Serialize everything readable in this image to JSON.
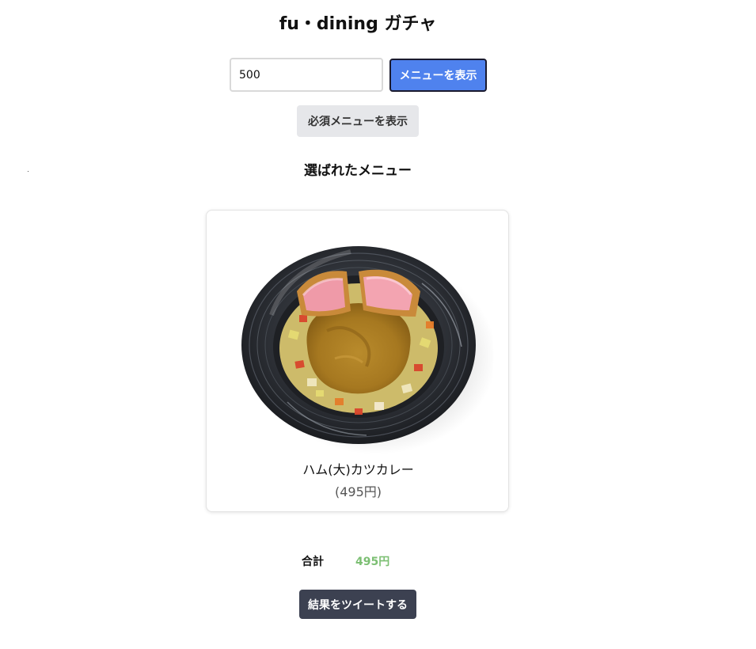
{
  "header": {
    "title": "fu・dining ガチャ"
  },
  "controls": {
    "amount_value": "500",
    "show_menu_label": "メニューを表示",
    "show_required_label": "必須メニューを表示"
  },
  "result": {
    "heading": "選ばれたメニュー",
    "items": [
      {
        "name": "ハム(大)カツカレー",
        "price": "(495円)",
        "image": "ham-katsu-curry-bowl"
      }
    ]
  },
  "total": {
    "label": "合計",
    "value": "495円",
    "color": "#7cbf73"
  },
  "share": {
    "tweet_label": "結果をツイートする"
  },
  "colors": {
    "primary": "#4f82ee",
    "secondary": "#e6e7ea",
    "dark": "#3c4151"
  }
}
